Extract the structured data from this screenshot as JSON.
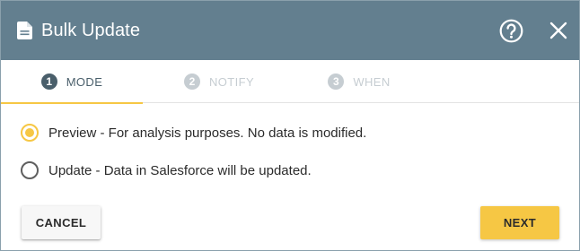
{
  "dialog": {
    "title": "Bulk Update",
    "title_icon": "document-icon",
    "help_icon": "help-circle-icon",
    "close_icon": "close-icon"
  },
  "tabs": [
    {
      "number": "1",
      "label": "MODE",
      "active": true
    },
    {
      "number": "2",
      "label": "NOTIFY",
      "active": false
    },
    {
      "number": "3",
      "label": "WHEN",
      "active": false
    }
  ],
  "options": [
    {
      "label": "Preview - For analysis purposes. No data is modified.",
      "selected": true
    },
    {
      "label": "Update - Data in Salesforce will be updated.",
      "selected": false
    }
  ],
  "footer": {
    "cancel_label": "CANCEL",
    "next_label": "NEXT"
  },
  "colors": {
    "header_bg": "#637f8f",
    "accent": "#f6c744",
    "active_tab": "#4a5f6b",
    "inactive_tab": "#c6cdd2"
  }
}
